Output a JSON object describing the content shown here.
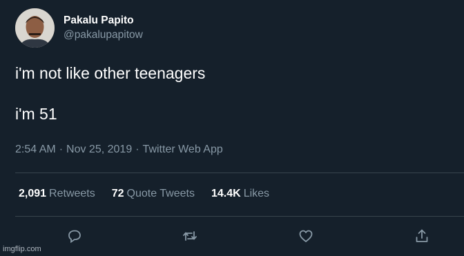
{
  "tweet": {
    "display_name": "Pakalu Papito",
    "handle": "@pakalupapitow",
    "text": "i'm not like other teenagers\n\ni'm 51",
    "time": "2:54 AM",
    "date": "Nov 25, 2019",
    "source": "Twitter Web App",
    "separator": "·"
  },
  "stats": {
    "retweets_count": "2,091",
    "retweets_label": "Retweets",
    "quote_count": "72",
    "quote_label": "Quote Tweets",
    "likes_count": "14.4K",
    "likes_label": "Likes"
  },
  "actions": {
    "reply_icon": "reply-icon",
    "retweet_icon": "retweet-icon",
    "like_icon": "heart-icon",
    "share_icon": "share-icon"
  },
  "watermark": "imgflip.com",
  "colors": {
    "background": "#15202b",
    "primary_text": "#ffffff",
    "secondary_text": "#8899a6",
    "divider": "#38444d"
  }
}
